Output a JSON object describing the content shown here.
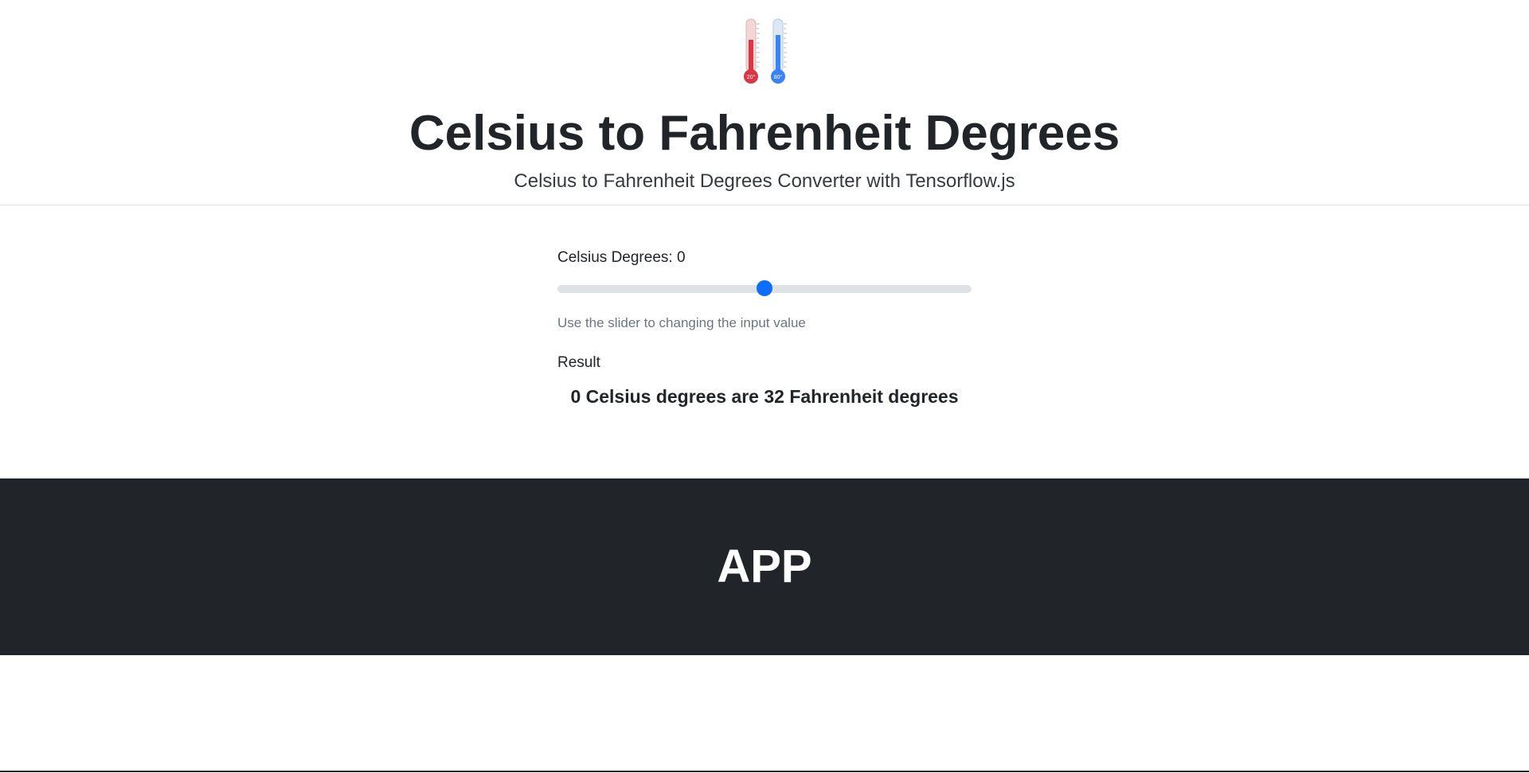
{
  "header": {
    "logo_icon": "thermometers-icon",
    "logo_left_reading": "20°",
    "logo_right_reading": "80°",
    "title": "Celsius to Fahrenheit Degrees",
    "subtitle": "Celsius to Fahrenheit Degrees Converter with Tensorflow.js"
  },
  "converter": {
    "celsius_label": "Celsius Degrees: 0",
    "slider_value_fraction": 0.5,
    "help_text": "Use the slider to changing the input value",
    "result_label": "Result",
    "result_text": "0 Celsius degrees are 32 Fahrenheit degrees"
  },
  "app_section": {
    "heading": "APP"
  },
  "colors": {
    "accent": "#0d6efd",
    "dark": "#212529",
    "thermo_red": "#dc3545",
    "thermo_blue": "#3b82f6"
  }
}
